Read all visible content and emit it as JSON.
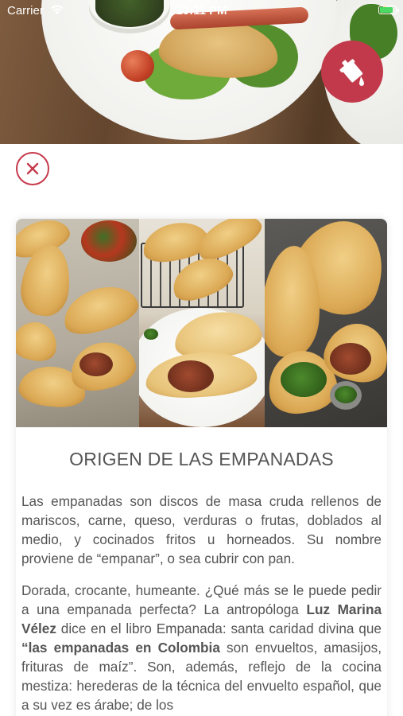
{
  "status_bar": {
    "carrier": "Carrier",
    "time": "10:11 PM",
    "battery_color": "#4cd964"
  },
  "hero": {
    "image": "empanadas-plate-photo",
    "action_icon": "paint-bucket-icon",
    "action_color": "#c1394a"
  },
  "close_button": {
    "icon": "close-icon",
    "color": "#c63a4d"
  },
  "article": {
    "image": "empanadas-collage-photo",
    "title": "ORIGEN DE LAS EMPANADAS",
    "p1": "Las empanadas son discos de masa cruda rellenos de mariscos, carne, queso, verduras o frutas, doblados al medio, y cocinados fritos u horneados. Su nombre proviene de “empanar”, o sea cubrir con pan.",
    "p2_a": "Dorada, crocante, humeante. ¿Qué más se le puede pedir a una empanada perfecta? La antropóloga ",
    "p2_b": "Luz Marina Vélez",
    "p2_c": " dice en el libro Empanada: santa caridad divina que ",
    "p2_d": "“las empanadas en Colombia",
    "p2_e": " son envueltos, amasijos, frituras de maíz”. Son, además, reflejo de la cocina mestiza: herederas de la técnica del envuelto español, que a su vez es árabe; de los"
  }
}
